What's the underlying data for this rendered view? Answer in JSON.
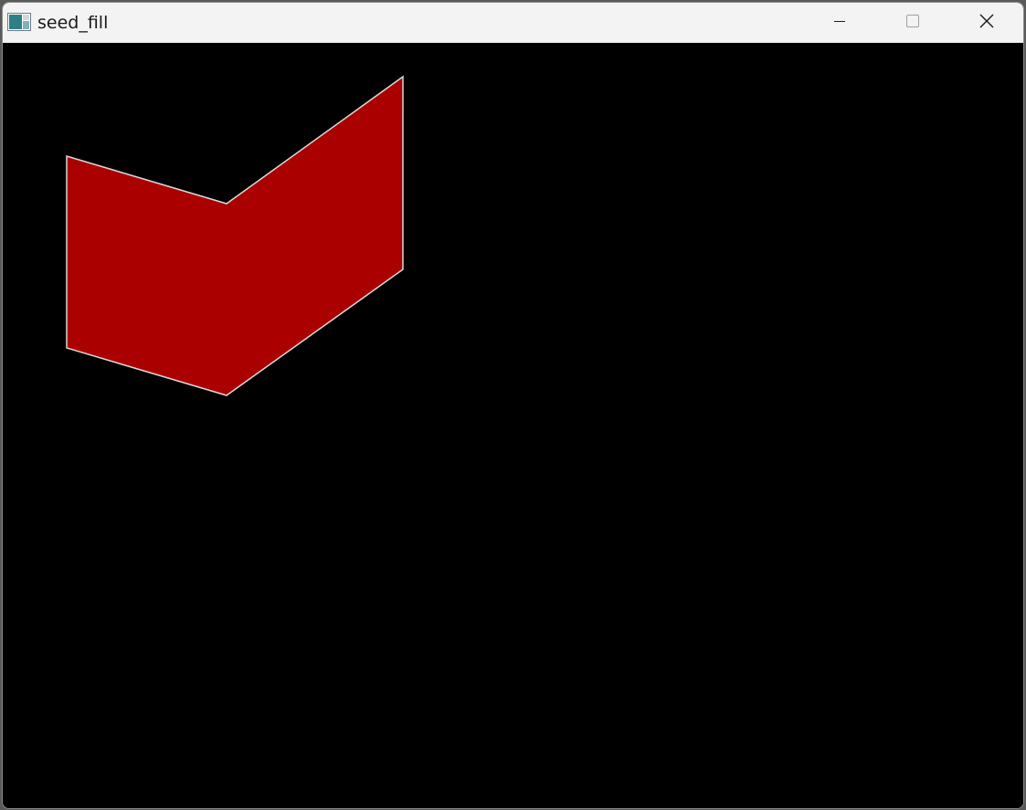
{
  "window": {
    "title": "seed_fill",
    "app_icon": "app-window-icon",
    "controls": {
      "minimize_icon": "minimize-icon",
      "maximize_icon": "maximize-icon",
      "close_icon": "close-icon"
    }
  },
  "canvas": {
    "background_color": "#000000",
    "shape": {
      "fill_color": "#aa0000",
      "outline_color": "#d9d9d9"
    }
  }
}
